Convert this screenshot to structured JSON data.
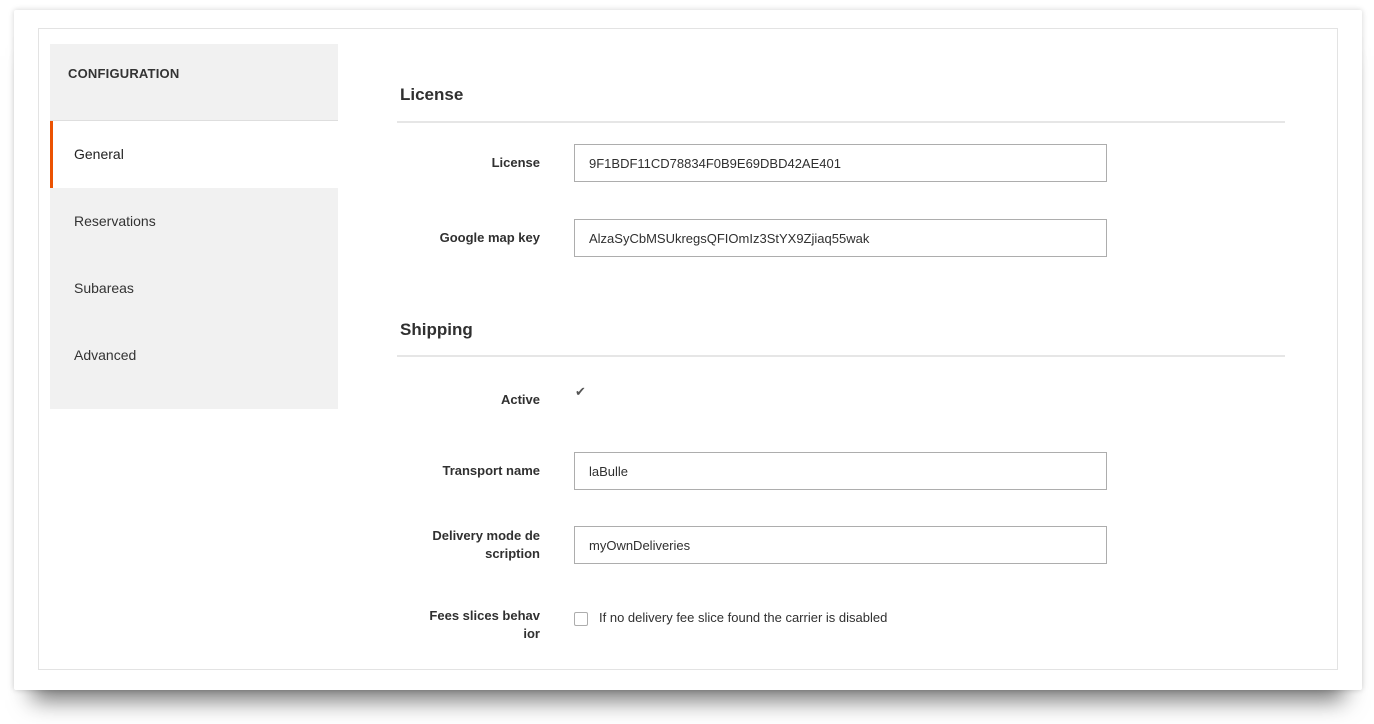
{
  "sidebar": {
    "header": "CONFIGURATION",
    "items": [
      {
        "label": "General",
        "active": true
      },
      {
        "label": "Reservations",
        "active": false
      },
      {
        "label": "Subareas",
        "active": false
      },
      {
        "label": "Advanced",
        "active": false
      }
    ]
  },
  "sections": {
    "license": {
      "title": "License",
      "fields": {
        "license": {
          "label": "License",
          "value": "9F1BDF11CD78834F0B9E69DBD42AE401"
        },
        "google_map_key": {
          "label": "Google map key",
          "value": "AlzaSyCbMSUkregsQFIOmIz3StYX9Zjiaq55wak"
        }
      }
    },
    "shipping": {
      "title": "Shipping",
      "fields": {
        "active": {
          "label": "Active",
          "checked": true
        },
        "transport_name": {
          "label": "Transport name",
          "value": "laBulle"
        },
        "delivery_mode": {
          "label_line1": "Delivery mode de",
          "label_line2": "scription",
          "value": "myOwnDeliveries"
        },
        "fees_slices": {
          "label_line1": "Fees slices behav",
          "label_line2": "ior",
          "checkbox_text": "If no delivery fee slice found the carrier is disabled",
          "checked": false
        }
      }
    }
  },
  "colors": {
    "accent": "#eb5202",
    "sidebar_bg": "#f1f1f1",
    "border": "#adadad"
  }
}
